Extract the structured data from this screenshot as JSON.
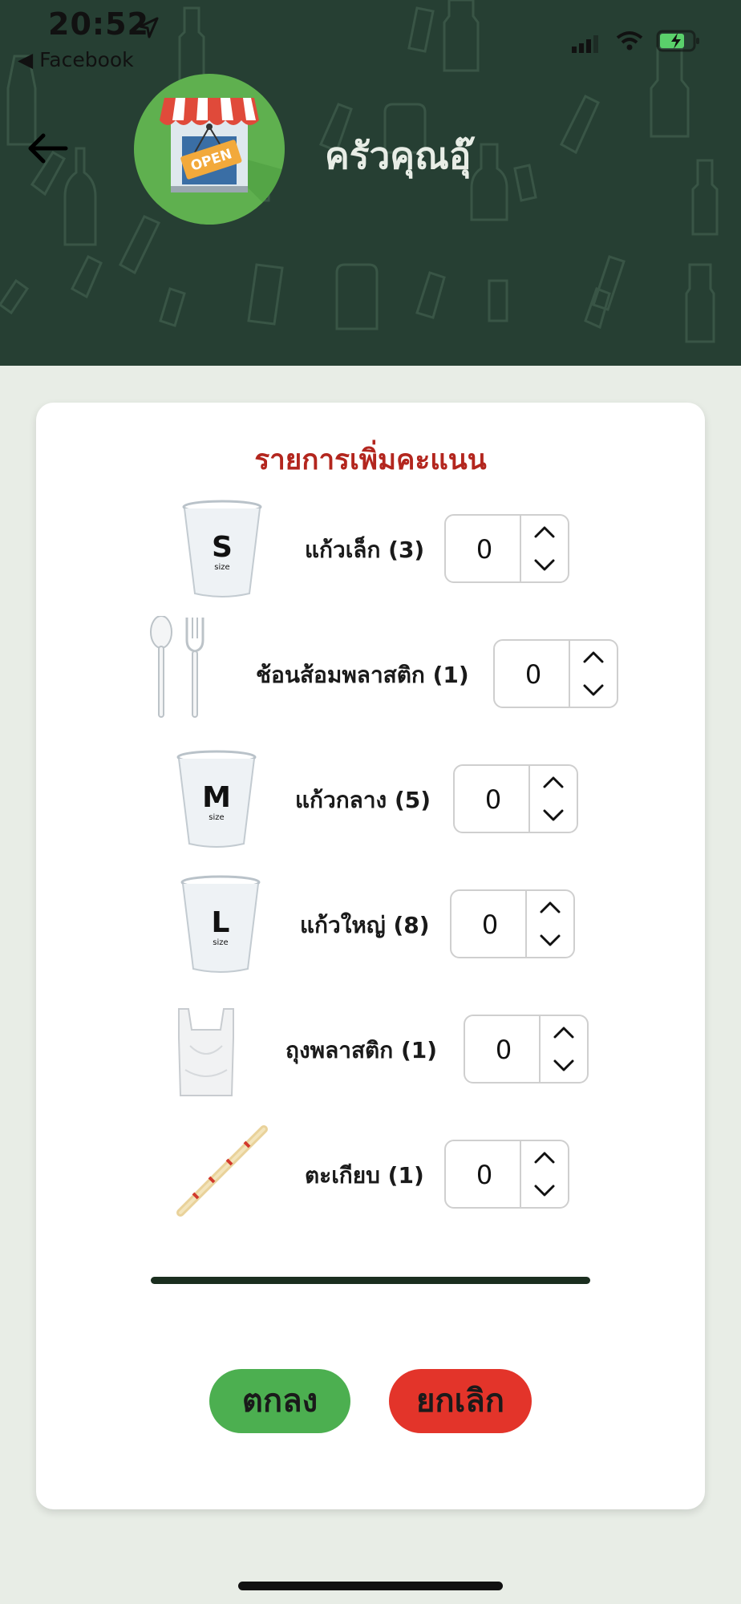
{
  "status_bar": {
    "time": "20:52",
    "back_app": "◀ Facebook"
  },
  "header": {
    "shop_name": "ครัวคุณอุ๊",
    "logo_sign": "OPEN"
  },
  "card": {
    "title": "รายการเพิ่มคะแนน",
    "items": [
      {
        "label": "แก้วเล็ก (3)",
        "value": "0",
        "icon": "small-cup-icon",
        "cup_letter": "S"
      },
      {
        "label": "ช้อนส้อมพลาสติก (1)",
        "value": "0",
        "icon": "spoon-fork-icon"
      },
      {
        "label": "แก้วกลาง (5)",
        "value": "0",
        "icon": "medium-cup-icon",
        "cup_letter": "M"
      },
      {
        "label": "แก้วใหญ่ (8)",
        "value": "0",
        "icon": "large-cup-icon",
        "cup_letter": "L"
      },
      {
        "label": "ถุงพลาสติก (1)",
        "value": "0",
        "icon": "plastic-bag-icon"
      },
      {
        "label": "ตะเกียบ (1)",
        "value": "0",
        "icon": "chopsticks-icon"
      }
    ],
    "cup_size_text": "size",
    "ok_label": "ตกลง",
    "cancel_label": "ยกเลิก"
  },
  "colors": {
    "header_bg": "#263f33",
    "title_red": "#b3261e",
    "ok_green": "#4caf50",
    "cancel_red": "#e3342a"
  }
}
